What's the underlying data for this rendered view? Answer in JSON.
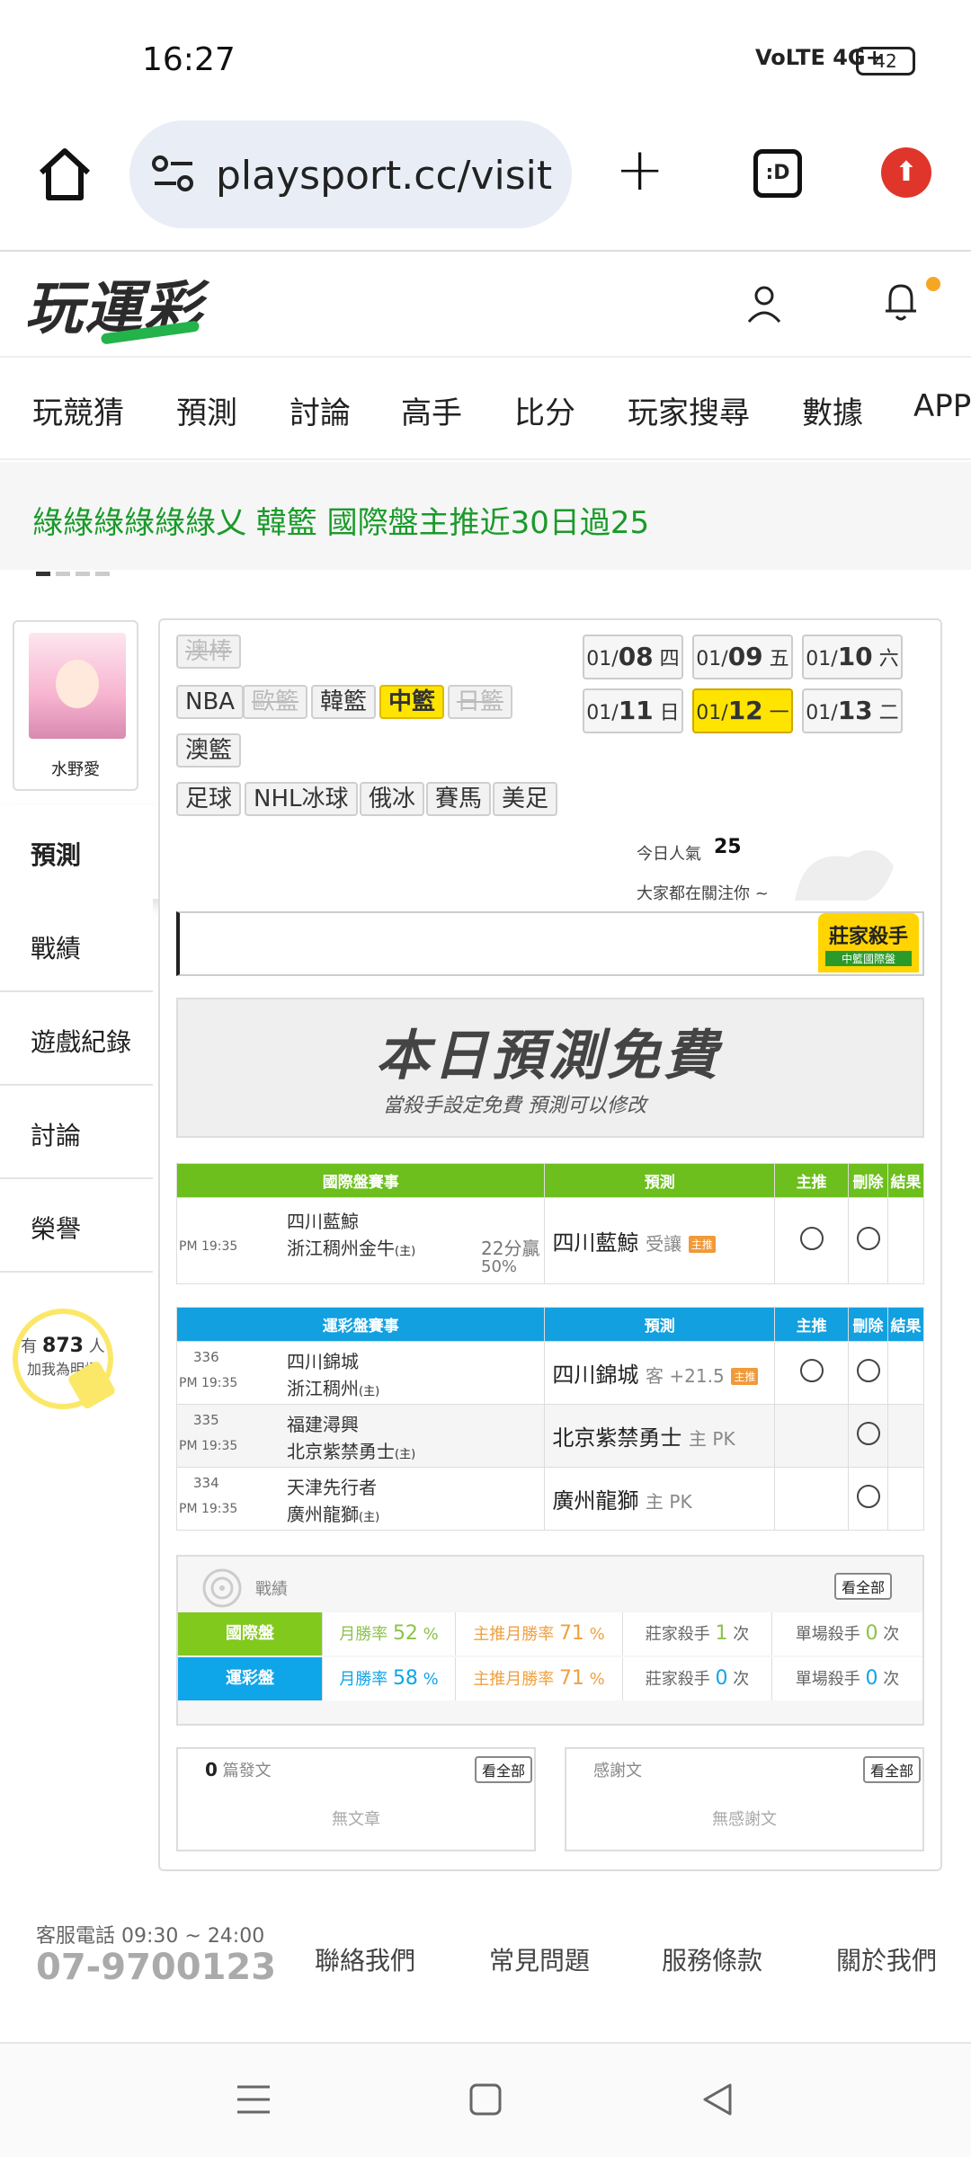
{
  "status": {
    "time": "16:27",
    "network": "VoLTE 4G+",
    "battery": "42"
  },
  "browser": {
    "url": "playsport.cc/visit"
  },
  "site": {
    "logo": "玩運彩"
  },
  "nav": [
    "玩競猜",
    "預測",
    "討論",
    "高手",
    "比分",
    "玩家搜尋",
    "數據",
    "APP"
  ],
  "ticker": "綠綠綠綠綠綠乂 韓籃 國際盤主推近30日過25",
  "profile": {
    "name": "水野愛"
  },
  "sidebar": [
    "預測",
    "戰績",
    "遊戲紀錄",
    "討論",
    "榮譽"
  ],
  "followers": {
    "prefix": "有",
    "count": "873",
    "suffix": "人",
    "caption": "加我為明燈"
  },
  "sports": {
    "row0": [
      "澳棒"
    ],
    "row1": [
      "NBA",
      "歐籃",
      "韓籃",
      "中籃",
      "日籃"
    ],
    "row2": [
      "澳籃"
    ],
    "row3": [
      "足球",
      "NHL冰球",
      "俄冰",
      "賽馬",
      "美足"
    ]
  },
  "dates": [
    {
      "m": "01/",
      "d": "08",
      "w": "四"
    },
    {
      "m": "01/",
      "d": "09",
      "w": "五"
    },
    {
      "m": "01/",
      "d": "10",
      "w": "六"
    },
    {
      "m": "01/",
      "d": "11",
      "w": "日"
    },
    {
      "m": "01/",
      "d": "12",
      "w": "一"
    },
    {
      "m": "01/",
      "d": "13",
      "w": "二"
    }
  ],
  "popularity": {
    "label": "今日人氣",
    "value": "25",
    "sub": "大家都在關注你 ~"
  },
  "killer_badge": {
    "title": "莊家殺手",
    "sub": "中籃國際盤"
  },
  "free_banner": {
    "title": "本日預測免費",
    "sub": "當殺手設定免費 預測可以修改"
  },
  "intl_table": {
    "headers": [
      "國際盤賽事",
      "預測",
      "主推",
      "刪除",
      "結果"
    ],
    "rows": [
      {
        "time": "PM 19:35",
        "team1": "四川藍鯨",
        "team2": "浙江稠州金牛",
        "home": "(主)",
        "line1": "22分贏",
        "line2": "50%",
        "pick": "四川藍鯨",
        "pick_sub": "受讓",
        "badge": "主推"
      }
    ]
  },
  "lottery_table": {
    "headers": [
      "運彩盤賽事",
      "預測",
      "主推",
      "刪除",
      "結果"
    ],
    "rows": [
      {
        "no": "336",
        "time": "PM 19:35",
        "team1": "四川錦城",
        "team2": "浙江稠州",
        "home": "(主)",
        "pick": "四川錦城",
        "pick_sub": "客 +21.5",
        "badge": "主推"
      },
      {
        "no": "335",
        "time": "PM 19:35",
        "team1": "福建潯興",
        "team2": "北京紫禁勇士",
        "home": "(主)",
        "pick": "北京紫禁勇士",
        "pick_sub": "主 PK",
        "badge": ""
      },
      {
        "no": "334",
        "time": "PM 19:35",
        "team1": "天津先行者",
        "team2": "廣州龍獅",
        "home": "(主)",
        "pick": "廣州龍獅",
        "pick_sub": "主 PK",
        "badge": ""
      }
    ]
  },
  "record": {
    "title": "戰績",
    "view_all": "看全部",
    "rows": [
      {
        "label": "國際盤",
        "c1": "月勝率",
        "v1": "52",
        "p": "%",
        "c2": "主推月勝率",
        "v2": "71",
        "c3": "莊家殺手",
        "v3": "1",
        "u": "次",
        "c4": "單場殺手",
        "v4": "0"
      },
      {
        "label": "運彩盤",
        "c1": "月勝率",
        "v1": "58",
        "p": "%",
        "c2": "主推月勝率",
        "v2": "71",
        "c3": "莊家殺手",
        "v3": "0",
        "u": "次",
        "c4": "單場殺手",
        "v4": "0"
      }
    ]
  },
  "posts": {
    "count": "0",
    "label": "篇發文",
    "view_all": "看全部",
    "empty": "無文章"
  },
  "thanks": {
    "label": "感謝文",
    "view_all": "看全部",
    "empty": "無感謝文"
  },
  "footer": {
    "hours": "客服電話 09:30 ~ 24:00",
    "phone": "07-9700123",
    "links": [
      "聯絡我們",
      "常見問題",
      "服務條款",
      "關於我們"
    ]
  },
  "colors": {
    "green": "#6cbf1c",
    "blue": "#12a0e0",
    "yellow": "#ffe400"
  }
}
